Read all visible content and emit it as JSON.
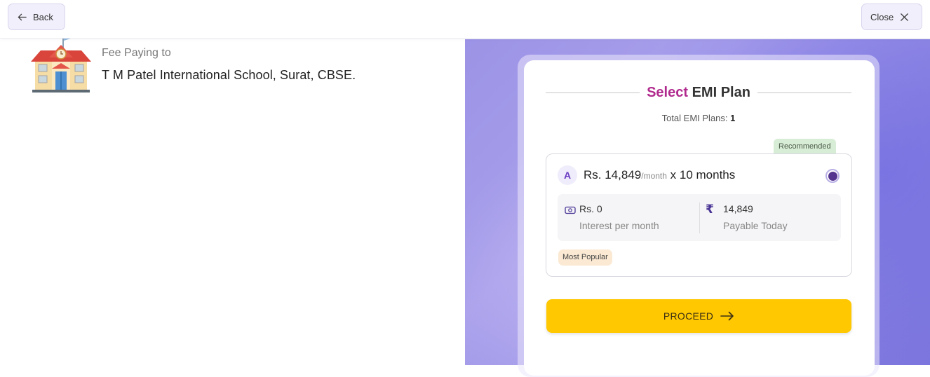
{
  "topbar": {
    "back_label": "Back",
    "close_label": "Close"
  },
  "payee": {
    "label": "Fee Paying to",
    "name": "T M Patel International School, Surat, CBSE."
  },
  "emi": {
    "title_accent": "Select",
    "title_rest": "EMI Plan",
    "total_label": "Total EMI Plans:",
    "total_count": "1",
    "plans": [
      {
        "letter": "A",
        "recommended_badge": "Recommended",
        "amount": "Rs. 14,849",
        "per": "/month",
        "tenure": "x 10 months",
        "selected": true,
        "interest_value": "Rs. 0",
        "interest_label": "Interest per month",
        "payable_value": "14,849",
        "payable_label": "Payable Today",
        "popular_badge": "Most Popular"
      }
    ],
    "proceed_label": "PROCEED"
  },
  "icons": {
    "back": "arrow-left-icon",
    "close": "close-icon",
    "school": "school-building-icon",
    "interest": "cash-icon",
    "rupee": "rupee-icon",
    "proceed": "arrow-right-icon"
  },
  "colors": {
    "accent_purple": "#55348f",
    "title_accent": "#b02a8e",
    "proceed_yellow": "#ffc800",
    "recommended_bg": "#d8edd6",
    "popular_bg": "#fbe9d3"
  }
}
